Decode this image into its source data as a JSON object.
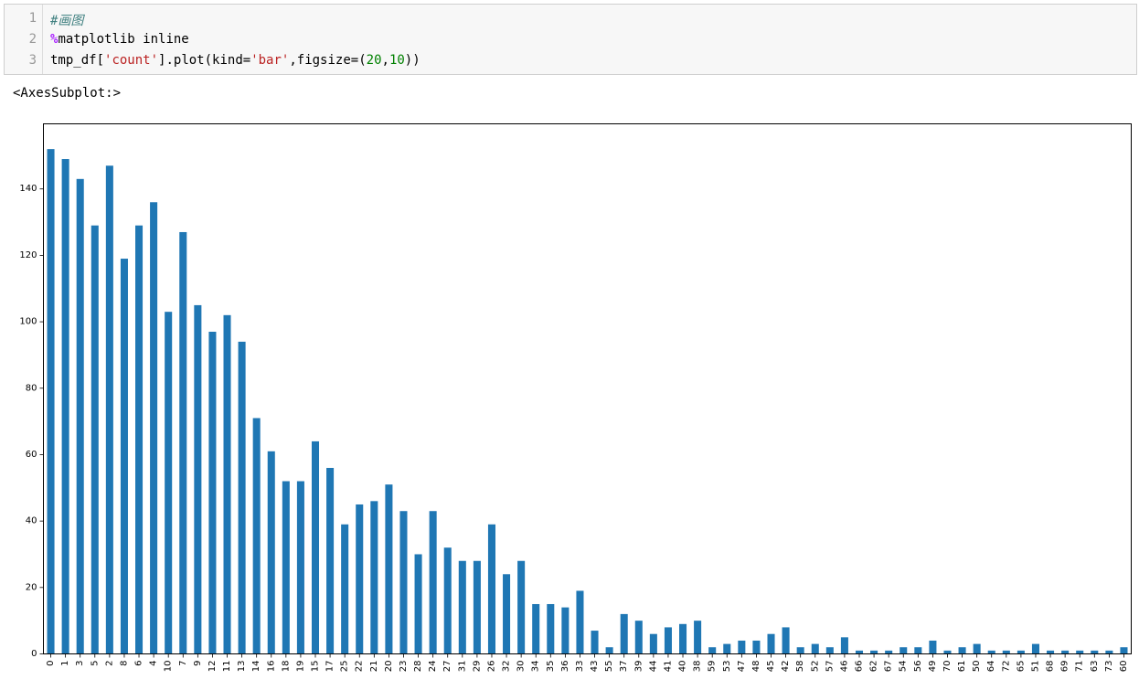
{
  "code_cell": {
    "line_numbers": [
      "1",
      "2",
      "3"
    ],
    "line1": "#画图",
    "line2_magic": "%",
    "line2_rest": "matplotlib inline",
    "line3_a": "tmp_df[",
    "line3_str1": "'count'",
    "line3_b": "].plot(kind=",
    "line3_str2": "'bar'",
    "line3_c": ",figsize=(",
    "line3_num1": "20",
    "line3_d": ",",
    "line3_num2": "10",
    "line3_e": "))"
  },
  "output": {
    "repr": "<AxesSubplot:>"
  },
  "colors": {
    "bar": "#1f77b4"
  },
  "chart_data": {
    "type": "bar",
    "categories": [
      "0",
      "1",
      "3",
      "5",
      "2",
      "8",
      "6",
      "4",
      "10",
      "7",
      "9",
      "12",
      "11",
      "13",
      "14",
      "16",
      "18",
      "19",
      "15",
      "17",
      "25",
      "22",
      "21",
      "20",
      "23",
      "28",
      "24",
      "27",
      "31",
      "29",
      "26",
      "32",
      "30",
      "34",
      "35",
      "36",
      "33",
      "43",
      "55",
      "37",
      "39",
      "44",
      "41",
      "40",
      "38",
      "59",
      "53",
      "47",
      "48",
      "45",
      "42",
      "58",
      "52",
      "57",
      "46",
      "66",
      "62",
      "67",
      "54",
      "56",
      "49",
      "70",
      "61",
      "50",
      "64",
      "72",
      "65",
      "51",
      "68",
      "69",
      "71",
      "63",
      "73",
      "60"
    ],
    "values": [
      152,
      149,
      143,
      129,
      147,
      119,
      129,
      136,
      103,
      127,
      105,
      97,
      102,
      94,
      71,
      61,
      52,
      52,
      64,
      56,
      39,
      45,
      46,
      51,
      43,
      30,
      43,
      32,
      28,
      28,
      39,
      24,
      28,
      15,
      15,
      14,
      19,
      7,
      2,
      12,
      10,
      6,
      8,
      9,
      10,
      2,
      3,
      4,
      4,
      6,
      8,
      2,
      3,
      2,
      5,
      1,
      1,
      1,
      2,
      2,
      4,
      1,
      2,
      3,
      1,
      1,
      1,
      3,
      1,
      1,
      1,
      1,
      1,
      2
    ],
    "yticks": [
      0,
      20,
      40,
      60,
      80,
      100,
      120,
      140
    ],
    "ylim": [
      0,
      159.6
    ],
    "title": "",
    "xlabel": "",
    "ylabel": "",
    "grid": false
  }
}
